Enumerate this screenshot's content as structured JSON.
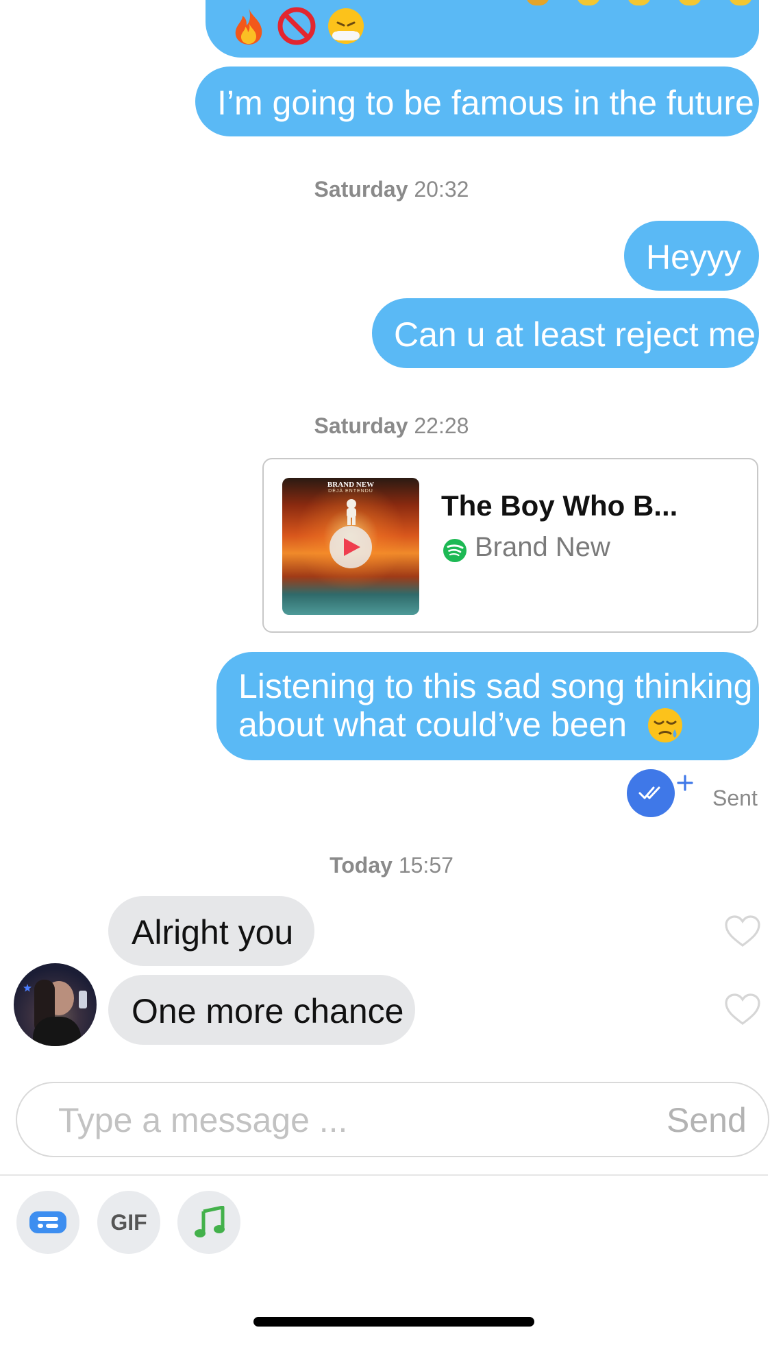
{
  "messages_top": {
    "emoji_row": [
      "fire",
      "no-entry",
      "steam-face"
    ],
    "famous": "I’m going to be famous in the future"
  },
  "timestamps": [
    {
      "day": "Saturday",
      "time": "20:32"
    },
    {
      "day": "Saturday",
      "time": "22:28"
    },
    {
      "day": "Today",
      "time": "15:57"
    }
  ],
  "messages_sat1": [
    "Heyyy",
    "Can u at least reject me"
  ],
  "song_card": {
    "title": "The Boy Who B...",
    "artist": "Brand New",
    "album_art_text_1": "BRAND NEW",
    "album_art_text_2": "DÉJÀ ENTENDU",
    "service_color": "#1db954"
  },
  "message_sad": {
    "line1": "Listening to this sad song thinking",
    "line2": "about what could’ve been"
  },
  "status": {
    "label": "Sent"
  },
  "incoming": [
    "Alright you",
    "One more chance"
  ],
  "composer": {
    "placeholder": "Type a message ...",
    "send_label": "Send"
  },
  "toolbar": {
    "gif_label": "GIF"
  },
  "colors": {
    "outgoing": "#5ab9f5",
    "incoming": "#e6e7e9",
    "read_badge": "#3f78e8"
  }
}
